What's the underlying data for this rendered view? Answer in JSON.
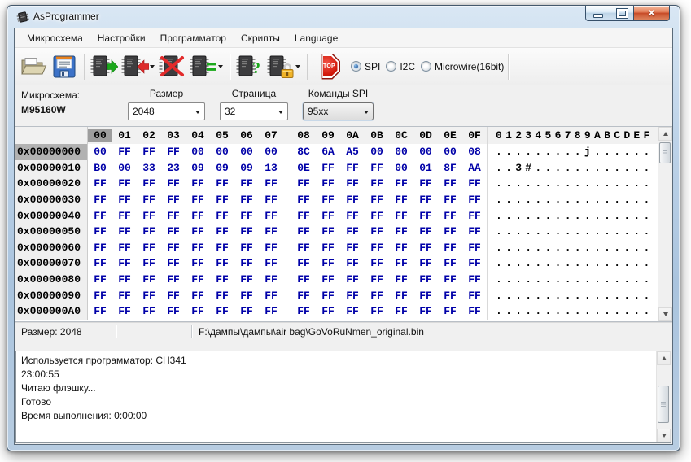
{
  "window": {
    "title": "AsProgrammer"
  },
  "menu": {
    "items": [
      "Микросхема",
      "Настройки",
      "Программатор",
      "Скрипты",
      "Language"
    ]
  },
  "toolbar": {
    "buttons": [
      {
        "name": "open-file",
        "icon": "folder-open"
      },
      {
        "name": "save-file",
        "icon": "floppy-disk"
      },
      {
        "name": "read-chip",
        "icon": "chip-arrow-right"
      },
      {
        "name": "write-chip",
        "icon": "chip-arrow-left",
        "has_dropdown": true
      },
      {
        "name": "erase-chip",
        "icon": "chip-red-x"
      },
      {
        "name": "verify-chip",
        "icon": "chip-equals",
        "has_dropdown": true
      },
      {
        "name": "detect-chip",
        "icon": "chip-question"
      },
      {
        "name": "unprotect-chip",
        "icon": "chip-lock",
        "has_dropdown": true
      },
      {
        "name": "stop",
        "icon": "stop-sign",
        "label": "STOP"
      }
    ],
    "radios": [
      {
        "label": "SPI",
        "selected": true
      },
      {
        "label": "I2C",
        "selected": false
      },
      {
        "label": "Microwire(16bit)",
        "selected": false
      }
    ]
  },
  "chip": {
    "label": "Микросхема:",
    "name": "M95160W",
    "size_label": "Размер",
    "size_value": "2048",
    "page_label": "Страница",
    "page_value": "32",
    "commands_label": "Команды SPI",
    "commands_value": "95xx"
  },
  "hex": {
    "column_headers": [
      "00",
      "01",
      "02",
      "03",
      "04",
      "05",
      "06",
      "07",
      "08",
      "09",
      "0A",
      "0B",
      "0C",
      "0D",
      "0E",
      "0F"
    ],
    "ascii_header": "0123456789ABCDEF",
    "selected": {
      "row": 0,
      "col": 0
    },
    "rows": [
      {
        "addr": "0x00000000",
        "bytes": [
          "00",
          "FF",
          "FF",
          "FF",
          "00",
          "00",
          "00",
          "00",
          "8C",
          "6A",
          "A5",
          "00",
          "00",
          "00",
          "00",
          "08"
        ],
        "ascii": ".........j......"
      },
      {
        "addr": "0x00000010",
        "bytes": [
          "B0",
          "00",
          "33",
          "23",
          "09",
          "09",
          "09",
          "13",
          "0E",
          "FF",
          "FF",
          "FF",
          "00",
          "01",
          "8F",
          "AA"
        ],
        "ascii": "..3#............"
      },
      {
        "addr": "0x00000020",
        "bytes": [
          "FF",
          "FF",
          "FF",
          "FF",
          "FF",
          "FF",
          "FF",
          "FF",
          "FF",
          "FF",
          "FF",
          "FF",
          "FF",
          "FF",
          "FF",
          "FF"
        ],
        "ascii": "................"
      },
      {
        "addr": "0x00000030",
        "bytes": [
          "FF",
          "FF",
          "FF",
          "FF",
          "FF",
          "FF",
          "FF",
          "FF",
          "FF",
          "FF",
          "FF",
          "FF",
          "FF",
          "FF",
          "FF",
          "FF"
        ],
        "ascii": "................"
      },
      {
        "addr": "0x00000040",
        "bytes": [
          "FF",
          "FF",
          "FF",
          "FF",
          "FF",
          "FF",
          "FF",
          "FF",
          "FF",
          "FF",
          "FF",
          "FF",
          "FF",
          "FF",
          "FF",
          "FF"
        ],
        "ascii": "................"
      },
      {
        "addr": "0x00000050",
        "bytes": [
          "FF",
          "FF",
          "FF",
          "FF",
          "FF",
          "FF",
          "FF",
          "FF",
          "FF",
          "FF",
          "FF",
          "FF",
          "FF",
          "FF",
          "FF",
          "FF"
        ],
        "ascii": "................"
      },
      {
        "addr": "0x00000060",
        "bytes": [
          "FF",
          "FF",
          "FF",
          "FF",
          "FF",
          "FF",
          "FF",
          "FF",
          "FF",
          "FF",
          "FF",
          "FF",
          "FF",
          "FF",
          "FF",
          "FF"
        ],
        "ascii": "................"
      },
      {
        "addr": "0x00000070",
        "bytes": [
          "FF",
          "FF",
          "FF",
          "FF",
          "FF",
          "FF",
          "FF",
          "FF",
          "FF",
          "FF",
          "FF",
          "FF",
          "FF",
          "FF",
          "FF",
          "FF"
        ],
        "ascii": "................"
      },
      {
        "addr": "0x00000080",
        "bytes": [
          "FF",
          "FF",
          "FF",
          "FF",
          "FF",
          "FF",
          "FF",
          "FF",
          "FF",
          "FF",
          "FF",
          "FF",
          "FF",
          "FF",
          "FF",
          "FF"
        ],
        "ascii": "................"
      },
      {
        "addr": "0x00000090",
        "bytes": [
          "FF",
          "FF",
          "FF",
          "FF",
          "FF",
          "FF",
          "FF",
          "FF",
          "FF",
          "FF",
          "FF",
          "FF",
          "FF",
          "FF",
          "FF",
          "FF"
        ],
        "ascii": "................"
      },
      {
        "addr": "0x000000A0",
        "bytes": [
          "FF",
          "FF",
          "FF",
          "FF",
          "FF",
          "FF",
          "FF",
          "FF",
          "FF",
          "FF",
          "FF",
          "FF",
          "FF",
          "FF",
          "FF",
          "FF"
        ],
        "ascii": "................"
      }
    ]
  },
  "statusbar": {
    "size": "Размер: 2048",
    "file_path": "F:\\дампы\\дампы\\air bag\\GoVoRuNmen_original.bin"
  },
  "log": {
    "lines": [
      "Используется программатор: CH341",
      "23:00:55",
      "Читаю флэшку...",
      "Готово",
      "Время выполнения: 0:00:00"
    ]
  },
  "colors": {
    "byte_text": "#0000A8",
    "selected_column_header_bg": "#9D9D9D",
    "selected_address_bg": "#B2B2B2",
    "close_button": "#C74A27",
    "radio_selected_dot": "#2A5D9E"
  }
}
